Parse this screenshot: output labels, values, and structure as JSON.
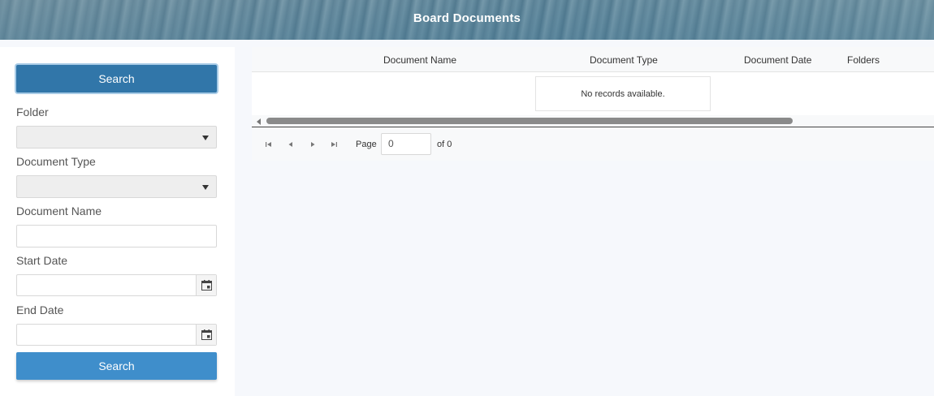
{
  "header": {
    "title": "Board Documents"
  },
  "sidebar": {
    "search_top_label": "Search",
    "folder_label": "Folder",
    "folder_value": "",
    "document_type_label": "Document Type",
    "document_type_value": "",
    "document_name_label": "Document Name",
    "document_name_value": "",
    "start_date_label": "Start Date",
    "start_date_value": "",
    "end_date_label": "End Date",
    "end_date_value": "",
    "search_bottom_label": "Search"
  },
  "grid": {
    "columns": [
      "Document Name",
      "Document Type",
      "Document Date",
      "Folders"
    ],
    "empty_message": "No records available."
  },
  "pager": {
    "page_label": "Page",
    "page_value": "0",
    "of_label": "of 0"
  },
  "colors": {
    "primary_button": "#3176a9",
    "secondary_button": "#3f8ecb",
    "page_background": "#f6f8fc"
  },
  "icons": {
    "calendar": "calendar-icon",
    "first": "first-page-icon",
    "prev": "previous-page-icon",
    "next": "next-page-icon",
    "last": "last-page-icon"
  }
}
